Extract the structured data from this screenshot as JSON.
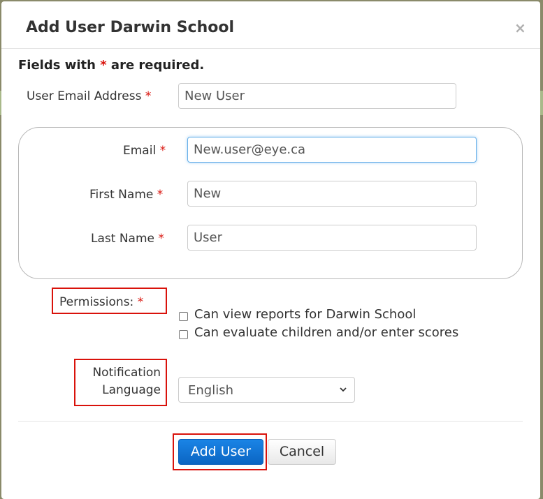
{
  "dialog": {
    "title": "Add User Darwin School",
    "close_symbol": "×",
    "required_note_prefix": "Fields with",
    "required_star": "*",
    "required_note_suffix": "are required."
  },
  "form": {
    "user_email_address": {
      "label": "User Email Address",
      "value": "New User"
    },
    "email": {
      "label": "Email",
      "value": "New.user@eye.ca"
    },
    "first_name": {
      "label": "First Name",
      "value": "New"
    },
    "last_name": {
      "label": "Last Name",
      "value": "User"
    },
    "permissions": {
      "label": "Permissions:",
      "options": [
        {
          "label": "Can view reports for Darwin School",
          "checked": false
        },
        {
          "label": "Can evaluate children and/or enter scores",
          "checked": false
        }
      ]
    },
    "notification_language": {
      "label_line1": "Notification",
      "label_line2": "Language",
      "selected": "English"
    }
  },
  "buttons": {
    "add_user": "Add User",
    "cancel": "Cancel"
  },
  "colors": {
    "required_star": "#d9120b",
    "highlight_box": "#d9120b",
    "primary_button": "#0b65c2",
    "focus_border": "#66afe9"
  },
  "icons": {
    "close": "close-icon",
    "dropdown": "chevron-down-icon"
  }
}
